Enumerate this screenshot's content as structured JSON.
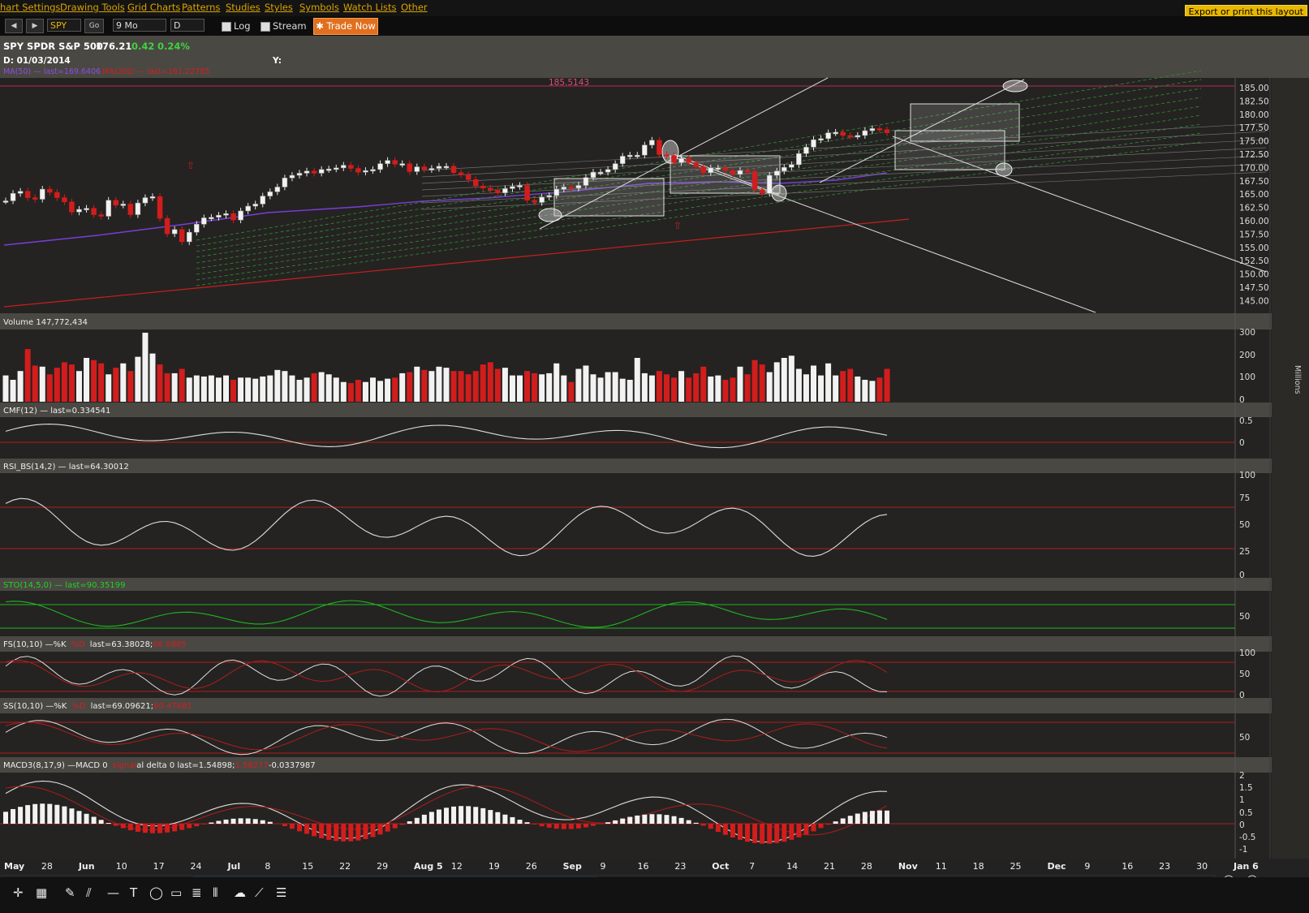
{
  "menu": [
    "hart Settings",
    "Drawing Tools",
    "Grid Charts",
    "Patterns",
    "Studies",
    "Styles",
    "Symbols",
    "Watch Lists",
    "Other"
  ],
  "export_label": "Export or print this layout",
  "toolbar": {
    "symbol": "SPY",
    "go": "Go",
    "period": "9 Mo",
    "interval": "D",
    "log": "Log",
    "stream": "Stream",
    "trade": "Trade Now"
  },
  "header": {
    "title": "SPY SPDR S&P 500",
    "price": "176.21",
    "change": "0.42",
    "change_pct": "0.24%",
    "date_label": "D: 01/03/2014",
    "y_label": "Y:",
    "ma50": "MA(50) — last=169.6406",
    "ma200": "MA(200) — last=161.22785"
  },
  "price_label": "185.5143",
  "panels": {
    "volume": "Volume 147,772,434",
    "cmf": "CMF(12) — last=0.334541",
    "rsi": "RSI_BS(14,2) — last=64.30012",
    "sto": "STO(14,5,0) — last=90.35199",
    "fs_a": "FS(10,10) —%K",
    "fs_b": "%D",
    "fs_c": "last=63.38028;",
    "fs_d": "66.0885",
    "ss_a": "SS(10,10) —%K",
    "ss_b": "%D",
    "ss_c": "last=69.09621;",
    "ss_d": "60.47681",
    "macd_a": "MACD3(8,17,9) —MACD 0",
    "macd_b": "signal",
    "macd_c": "al delta 0 last=1.54898;",
    "macd_d": "1.58277",
    "macd_e": "-0.0337987",
    "millions": "Millions"
  },
  "axes": {
    "price": [
      "185.00",
      "182.50",
      "180.00",
      "177.50",
      "175.00",
      "172.50",
      "170.00",
      "167.50",
      "165.00",
      "162.50",
      "160.00",
      "157.50",
      "155.00",
      "152.50",
      "150.00",
      "147.50",
      "145.00"
    ],
    "volume": [
      "300",
      "200",
      "100",
      "0"
    ],
    "cmf": [
      "0.5",
      "0"
    ],
    "rsi": [
      "100",
      "75",
      "50",
      "25",
      "0"
    ],
    "sto": [
      "50"
    ],
    "fs": [
      "100",
      "50",
      "0"
    ],
    "ss": [
      "50"
    ],
    "macd": [
      "2",
      "1.5",
      "1",
      "0.5",
      "0",
      "-0.5",
      "-1"
    ]
  },
  "x_labels": [
    {
      "t": "May",
      "m": 1
    },
    {
      "t": "28",
      "m": 0
    },
    {
      "t": "Jun",
      "m": 1
    },
    {
      "t": "10",
      "m": 0
    },
    {
      "t": "17",
      "m": 0
    },
    {
      "t": "24",
      "m": 0
    },
    {
      "t": "Jul",
      "m": 1
    },
    {
      "t": "8",
      "m": 0
    },
    {
      "t": "15",
      "m": 0
    },
    {
      "t": "22",
      "m": 0
    },
    {
      "t": "29",
      "m": 0
    },
    {
      "t": "Aug 5",
      "m": 1
    },
    {
      "t": "12",
      "m": 0
    },
    {
      "t": "19",
      "m": 0
    },
    {
      "t": "26",
      "m": 0
    },
    {
      "t": "Sep",
      "m": 1
    },
    {
      "t": "9",
      "m": 0
    },
    {
      "t": "16",
      "m": 0
    },
    {
      "t": "23",
      "m": 0
    },
    {
      "t": "Oct",
      "m": 1
    },
    {
      "t": "7",
      "m": 0
    },
    {
      "t": "14",
      "m": 0
    },
    {
      "t": "21",
      "m": 0
    },
    {
      "t": "28",
      "m": 0
    },
    {
      "t": "Nov",
      "m": 1
    },
    {
      "t": "11",
      "m": 0
    },
    {
      "t": "18",
      "m": 0
    },
    {
      "t": "25",
      "m": 0
    },
    {
      "t": "Dec",
      "m": 1
    },
    {
      "t": "9",
      "m": 0
    },
    {
      "t": "16",
      "m": 0
    },
    {
      "t": "23",
      "m": 0
    },
    {
      "t": "30",
      "m": 0
    },
    {
      "t": "Jan 6",
      "m": 1
    }
  ],
  "chart_data": {
    "type": "candlestick",
    "title": "SPY SPDR S&P 500",
    "x_range": [
      "2013-05-21",
      "2014-01-06"
    ],
    "price_range": [
      145,
      185
    ],
    "close": [
      163.4,
      164.8,
      165.2,
      164.0,
      163.7,
      165.6,
      165.0,
      164.0,
      163.2,
      161.3,
      161.8,
      162.0,
      160.8,
      160.5,
      163.5,
      162.6,
      162.8,
      160.8,
      163.0,
      164.0,
      164.2,
      160.1,
      157.2,
      158.0,
      155.7,
      157.5,
      159.0,
      160.2,
      160.3,
      160.7,
      161.0,
      159.8,
      161.5,
      162.4,
      162.8,
      164.3,
      165.1,
      166.0,
      167.7,
      168.2,
      168.6,
      169.0,
      168.6,
      169.3,
      169.4,
      169.6,
      170.1,
      169.5,
      168.8,
      169.1,
      169.3,
      170.4,
      171.0,
      170.3,
      170.4,
      168.9,
      169.8,
      169.3,
      169.5,
      169.9,
      169.9,
      168.7,
      168.3,
      167.4,
      166.2,
      165.8,
      165.4,
      164.9,
      165.7,
      166.1,
      166.3,
      163.5,
      163.1,
      164.1,
      164.4,
      165.6,
      166.0,
      165.8,
      166.3,
      167.8,
      168.8,
      168.8,
      169.3,
      170.4,
      171.8,
      172.0,
      172.0,
      173.9,
      174.8,
      172.1,
      171.9,
      170.6,
      171.4,
      170.6,
      169.8,
      168.7,
      169.6,
      169.6,
      169.1,
      168.4,
      169.1,
      168.9,
      165.5,
      164.8,
      168.2,
      169.0,
      169.7,
      170.2,
      172.3,
      173.5,
      174.9,
      175.1,
      176.2,
      176.3,
      175.7,
      175.6,
      175.7,
      176.6,
      177.0,
      176.8,
      176.2
    ],
    "volume_millions": [
      120,
      100,
      140,
      240,
      165,
      160,
      125,
      155,
      180,
      170,
      140,
      200,
      190,
      175,
      125,
      155,
      175,
      140,
      205,
      315,
      220,
      170,
      130,
      130,
      150,
      110,
      120,
      115,
      120,
      110,
      120,
      100,
      110,
      110,
      105,
      115,
      120,
      145,
      140,
      120,
      100,
      110,
      130,
      135,
      125,
      110,
      90,
      85,
      100,
      90,
      110,
      95,
      105,
      110,
      130,
      135,
      160,
      145,
      140,
      160,
      155,
      140,
      140,
      125,
      140,
      170,
      180,
      150,
      155,
      120,
      120,
      140,
      130,
      125,
      130,
      175,
      120,
      90,
      150,
      165,
      125,
      110,
      135,
      135,
      105,
      100,
      200,
      130,
      120,
      140,
      125,
      110,
      140,
      110,
      130,
      160,
      115,
      120,
      100,
      110,
      160,
      125,
      190,
      170,
      135,
      180,
      200,
      210,
      150,
      125,
      165,
      120,
      175,
      120,
      140,
      150,
      115,
      100,
      95,
      110,
      150,
      160,
      150
    ],
    "ma50_last": 169.6406,
    "ma200_last": 161.22785,
    "price_level": 185.5143
  }
}
